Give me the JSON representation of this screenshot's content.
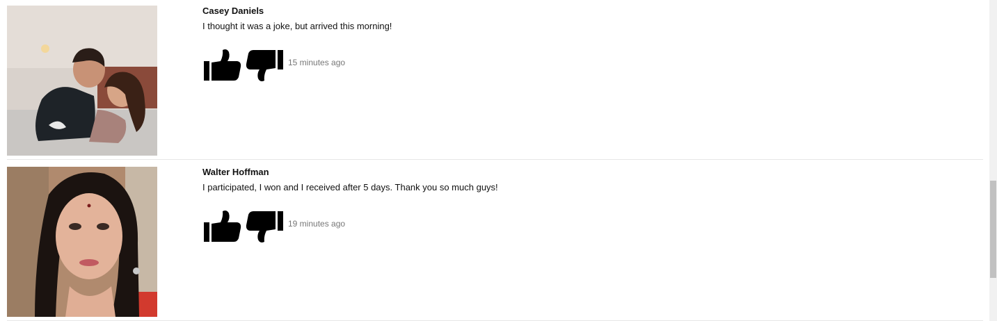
{
  "comments": [
    {
      "name": "Casey Daniels",
      "text": "I thought it was a joke, but arrived this morning!",
      "time": "15 minutes ago"
    },
    {
      "name": "Walter Hoffman",
      "text": "I participated, I won and I received after 5 days. Thank you so much guys!",
      "time": "19 minutes ago"
    }
  ],
  "icons": {
    "like": "thumbs-up-icon",
    "dislike": "thumbs-down-icon"
  },
  "colors": {
    "icon": "#000000",
    "time": "#777777",
    "divider": "#e6e6e6"
  }
}
